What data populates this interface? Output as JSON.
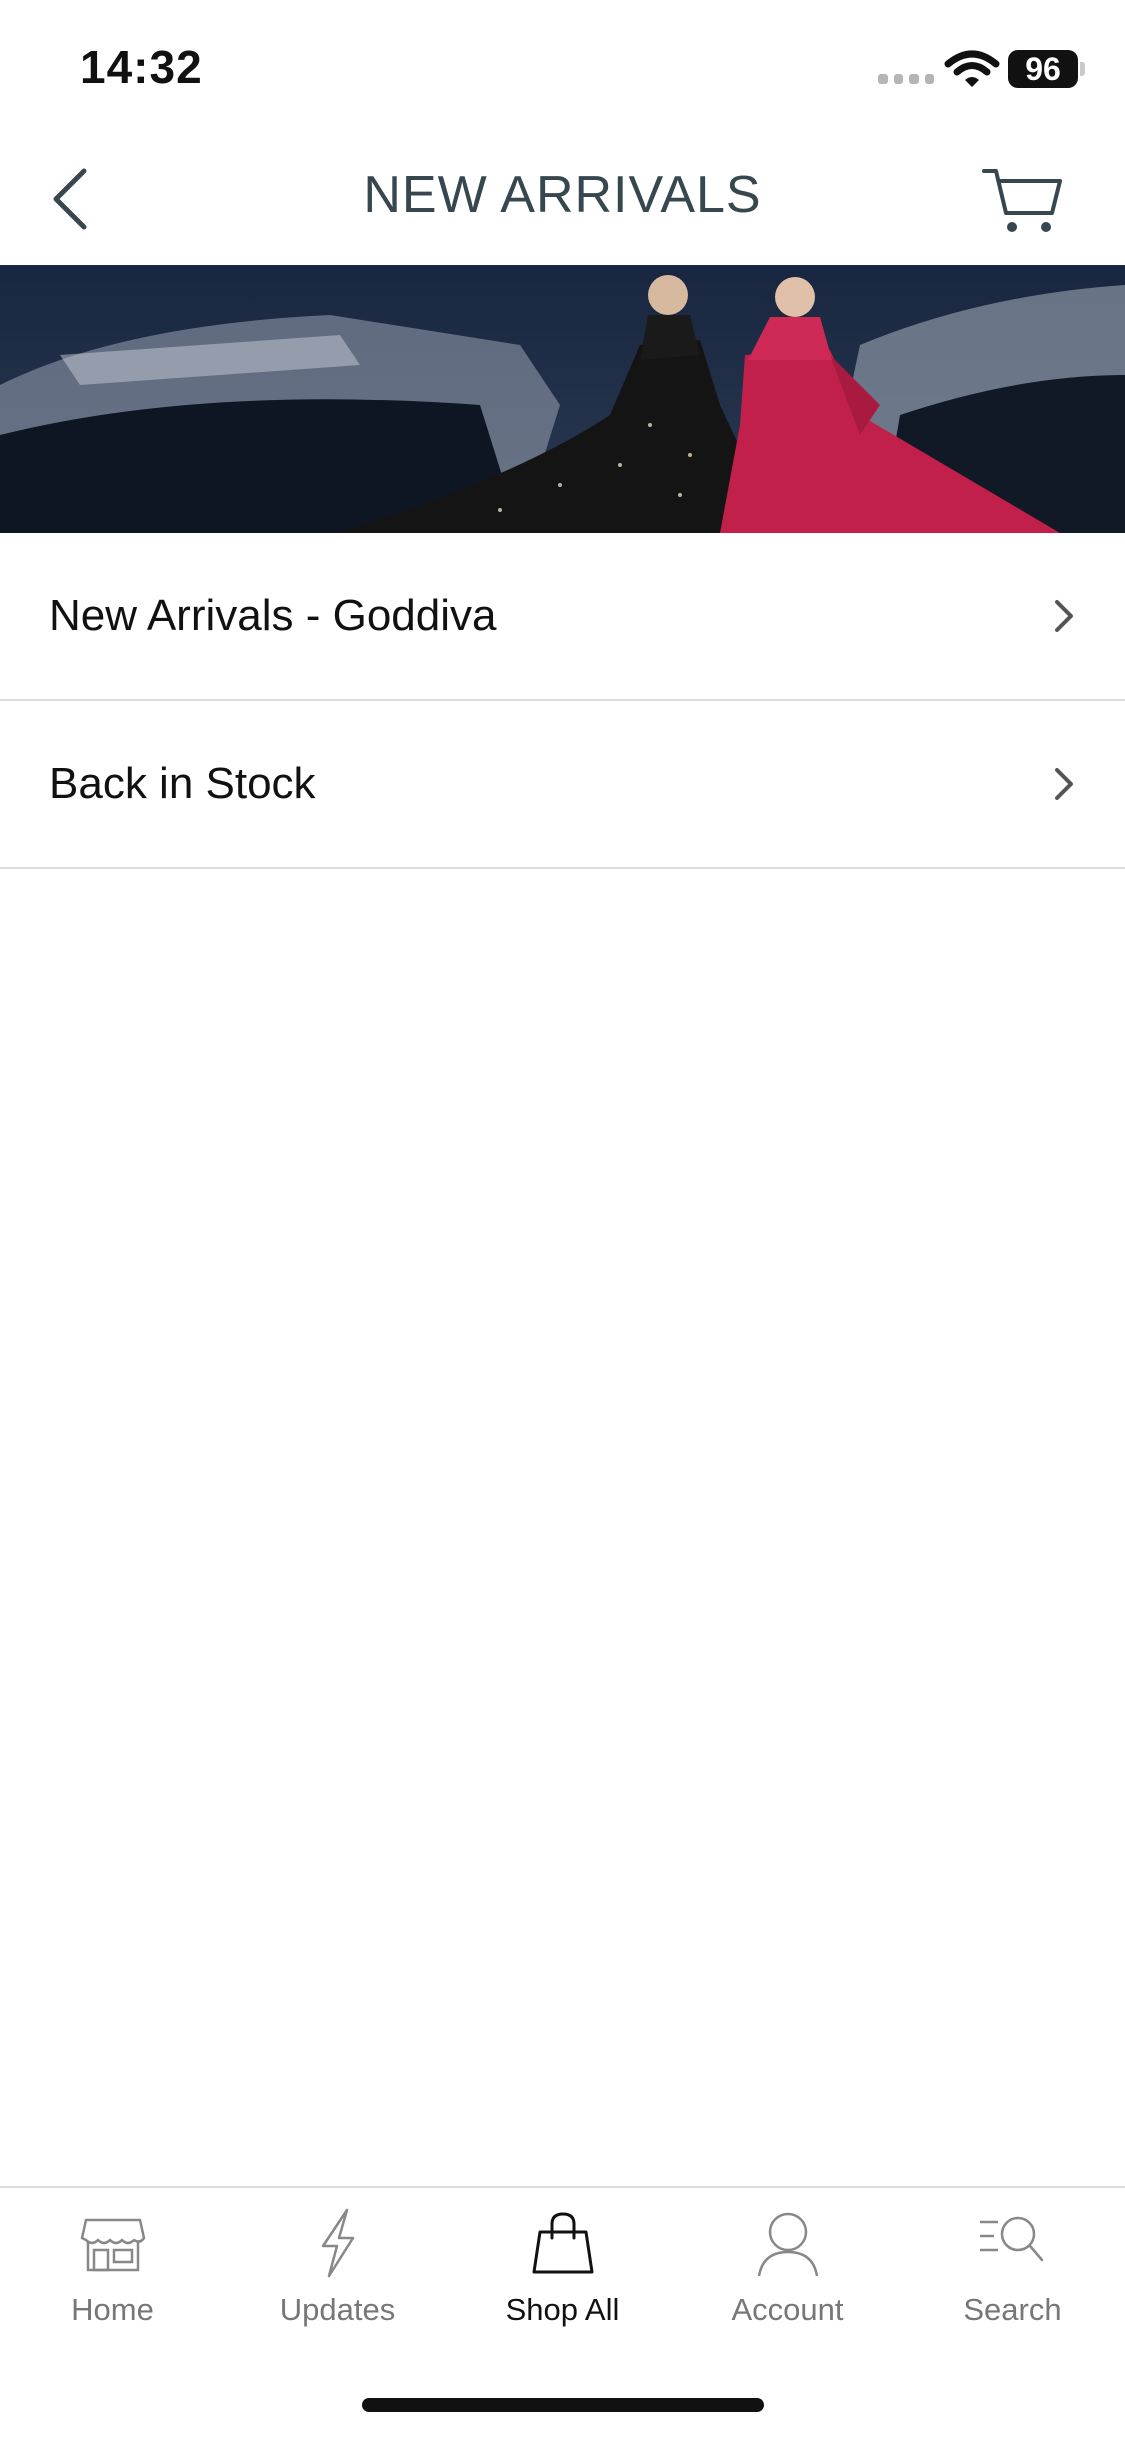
{
  "status_bar": {
    "time": "14:32",
    "battery": "96",
    "icons": [
      "signal-icon",
      "wifi-icon",
      "battery-icon"
    ]
  },
  "nav": {
    "title": "NEW ARRIVALS",
    "back_icon": "chevron-left-icon",
    "cart_icon": "cart-icon"
  },
  "banner": {
    "image": "two-models-in-evening-gowns-on-yacht",
    "colors": {
      "sky": "#1a2a44",
      "black_gown": "#111111",
      "red_gown": "#c0204a"
    }
  },
  "list": {
    "items": [
      {
        "label": "New Arrivals - Goddiva",
        "icon": "chevron-right-icon"
      },
      {
        "label": "Back in Stock",
        "icon": "chevron-right-icon"
      }
    ]
  },
  "tab_bar": {
    "tabs": [
      {
        "label": "Home",
        "icon": "store-icon",
        "active": false
      },
      {
        "label": "Updates",
        "icon": "lightning-icon",
        "active": false
      },
      {
        "label": "Shop All",
        "icon": "shopping-bag-icon",
        "active": true
      },
      {
        "label": "Account",
        "icon": "user-icon",
        "active": false
      },
      {
        "label": "Search",
        "icon": "search-icon",
        "active": false
      }
    ]
  },
  "colors": {
    "title": "#37474f",
    "divider": "#dcdcdc",
    "inactive_tab": "#777777",
    "active_tab": "#111111"
  }
}
